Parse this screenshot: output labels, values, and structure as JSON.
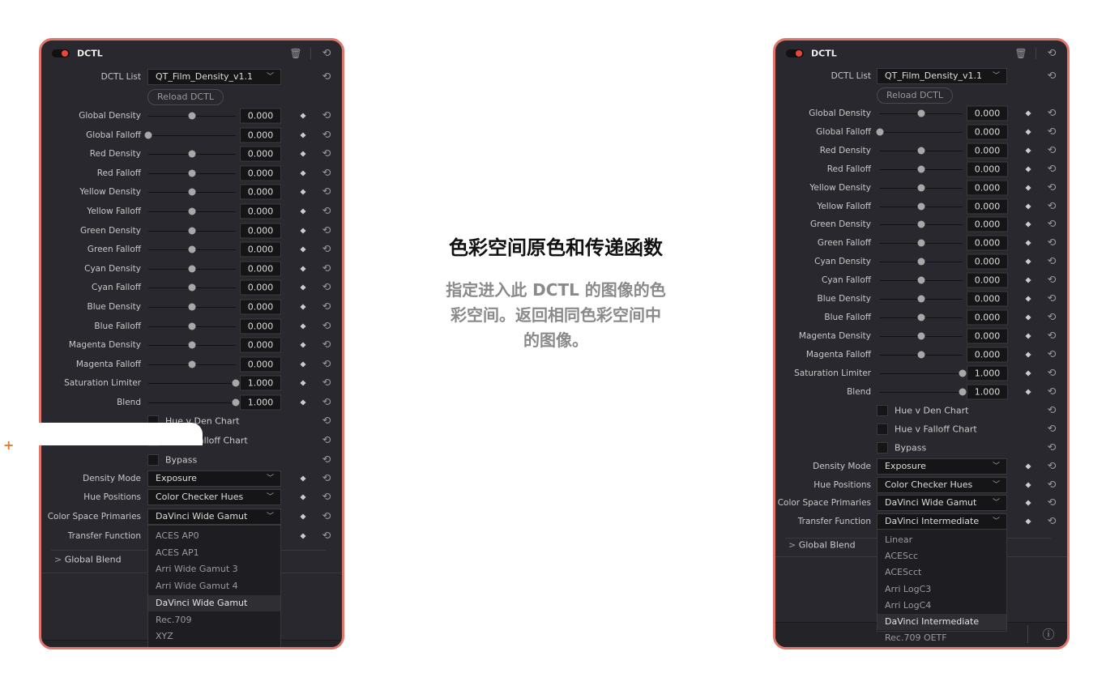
{
  "accent": "#e0766b",
  "center": {
    "title": "色彩空间原色和传递函数",
    "lines": [
      "指定进入此 DCTL 的图像的色",
      "彩空间。返回相同色彩空间中",
      "的图像。"
    ]
  },
  "panels": [
    {
      "title": "DCTL",
      "dctl_list": {
        "label": "DCTL List",
        "value": "QT_Film_Density_v1.1"
      },
      "reload_label": "Reload DCTL",
      "sliders": [
        {
          "label": "Global Density",
          "value": "0.000",
          "fraction": 0.5
        },
        {
          "label": "Global Falloff",
          "value": "0.000",
          "fraction": 0
        },
        {
          "label": "Red Density",
          "value": "0.000",
          "fraction": 0.5
        },
        {
          "label": "Red Falloff",
          "value": "0.000",
          "fraction": 0.5
        },
        {
          "label": "Yellow Density",
          "value": "0.000",
          "fraction": 0.5
        },
        {
          "label": "Yellow Falloff",
          "value": "0.000",
          "fraction": 0.5
        },
        {
          "label": "Green Density",
          "value": "0.000",
          "fraction": 0.5
        },
        {
          "label": "Green Falloff",
          "value": "0.000",
          "fraction": 0.5
        },
        {
          "label": "Cyan Density",
          "value": "0.000",
          "fraction": 0.5
        },
        {
          "label": "Cyan Falloff",
          "value": "0.000",
          "fraction": 0.5
        },
        {
          "label": "Blue Density",
          "value": "0.000",
          "fraction": 0.5
        },
        {
          "label": "Blue Falloff",
          "value": "0.000",
          "fraction": 0.5
        },
        {
          "label": "Magenta Density",
          "value": "0.000",
          "fraction": 0.5
        },
        {
          "label": "Magenta Falloff",
          "value": "0.000",
          "fraction": 0.5
        },
        {
          "label": "Saturation Limiter",
          "value": "1.000",
          "fraction": 1
        },
        {
          "label": "Blend",
          "value": "1.000",
          "fraction": 1
        }
      ],
      "checkboxes": [
        {
          "label": "Hue v Den Chart",
          "checked": false
        },
        {
          "label": "Hue v Falloff Chart",
          "checked": false
        },
        {
          "label": "Bypass",
          "checked": false
        }
      ],
      "dropdowns": [
        {
          "label": "Density Mode",
          "value": "Exposure"
        },
        {
          "label": "Hue Positions",
          "value": "Color Checker Hues"
        },
        {
          "label": "Color Space Primaries",
          "value": "DaVinci Wide Gamut"
        },
        {
          "label": "Transfer Function",
          "value": ""
        }
      ],
      "open_menu_index": 2,
      "menu_items": [
        "ACES AP0",
        "ACES AP1",
        "Arri Wide Gamut 3",
        "Arri Wide Gamut 4",
        "DaVinci Wide Gamut",
        "Rec.709",
        "XYZ"
      ],
      "menu_selected": 4,
      "global_blend": "Global Blend"
    },
    {
      "title": "DCTL",
      "dctl_list": {
        "label": "DCTL List",
        "value": "QT_Film_Density_v1.1"
      },
      "reload_label": "Reload DCTL",
      "sliders": [
        {
          "label": "Global Density",
          "value": "0.000",
          "fraction": 0.5
        },
        {
          "label": "Global Falloff",
          "value": "0.000",
          "fraction": 0
        },
        {
          "label": "Red Density",
          "value": "0.000",
          "fraction": 0.5
        },
        {
          "label": "Red Falloff",
          "value": "0.000",
          "fraction": 0.5
        },
        {
          "label": "Yellow Density",
          "value": "0.000",
          "fraction": 0.5
        },
        {
          "label": "Yellow Falloff",
          "value": "0.000",
          "fraction": 0.5
        },
        {
          "label": "Green Density",
          "value": "0.000",
          "fraction": 0.5
        },
        {
          "label": "Green Falloff",
          "value": "0.000",
          "fraction": 0.5
        },
        {
          "label": "Cyan Density",
          "value": "0.000",
          "fraction": 0.5
        },
        {
          "label": "Cyan Falloff",
          "value": "0.000",
          "fraction": 0.5
        },
        {
          "label": "Blue Density",
          "value": "0.000",
          "fraction": 0.5
        },
        {
          "label": "Blue Falloff",
          "value": "0.000",
          "fraction": 0.5
        },
        {
          "label": "Magenta Density",
          "value": "0.000",
          "fraction": 0.5
        },
        {
          "label": "Magenta Falloff",
          "value": "0.000",
          "fraction": 0.5
        },
        {
          "label": "Saturation Limiter",
          "value": "1.000",
          "fraction": 1
        },
        {
          "label": "Blend",
          "value": "1.000",
          "fraction": 1
        }
      ],
      "checkboxes": [
        {
          "label": "Hue v Den Chart",
          "checked": false
        },
        {
          "label": "Hue v Falloff Chart",
          "checked": false
        },
        {
          "label": "Bypass",
          "checked": false
        }
      ],
      "dropdowns": [
        {
          "label": "Density Mode",
          "value": "Exposure"
        },
        {
          "label": "Hue Positions",
          "value": "Color Checker Hues"
        },
        {
          "label": "Color Space Primaries",
          "value": "DaVinci Wide Gamut"
        },
        {
          "label": "Transfer Function",
          "value": "DaVinci Intermediate"
        }
      ],
      "open_menu_index": 3,
      "menu_items": [
        "Linear",
        "ACEScc",
        "ACEScct",
        "Arri LogC3",
        "Arri LogC4",
        "DaVinci Intermediate",
        "Rec.709 OETF"
      ],
      "menu_selected": 5,
      "global_blend": "Global Blend"
    }
  ]
}
